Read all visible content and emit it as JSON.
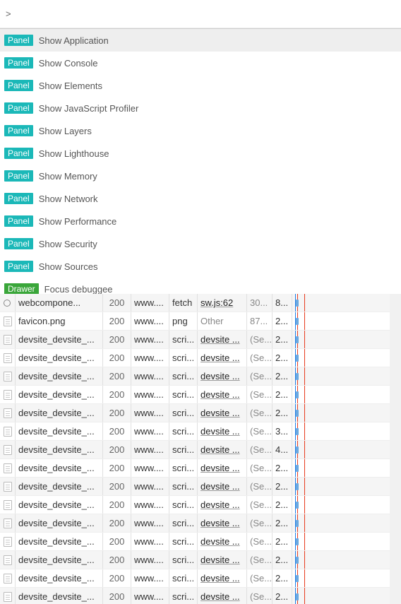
{
  "prompt": ">",
  "badges": {
    "panel": "Panel",
    "drawer": "Drawer"
  },
  "commands": [
    {
      "badge": "panel",
      "label": "Show Application",
      "selected": true
    },
    {
      "badge": "panel",
      "label": "Show Console"
    },
    {
      "badge": "panel",
      "label": "Show Elements"
    },
    {
      "badge": "panel",
      "label": "Show JavaScript Profiler"
    },
    {
      "badge": "panel",
      "label": "Show Layers"
    },
    {
      "badge": "panel",
      "label": "Show Lighthouse"
    },
    {
      "badge": "panel",
      "label": "Show Memory"
    },
    {
      "badge": "panel",
      "label": "Show Network"
    },
    {
      "badge": "panel",
      "label": "Show Performance"
    },
    {
      "badge": "panel",
      "label": "Show Security"
    },
    {
      "badge": "panel",
      "label": "Show Sources"
    },
    {
      "badge": "drawer",
      "label": "Focus debuggee"
    }
  ],
  "network": {
    "rows": [
      {
        "icon": "gear",
        "name": "webcompone...",
        "status": "200",
        "domain": "www....",
        "type": "fetch",
        "initiator": "sw.js:62",
        "init_is_link": true,
        "size": "30...",
        "time": "8..."
      },
      {
        "icon": "file",
        "name": "favicon.png",
        "status": "200",
        "domain": "www....",
        "type": "png",
        "initiator": "Other",
        "init_is_link": false,
        "size": "87...",
        "time": "2..."
      },
      {
        "icon": "file",
        "name": "devsite_devsite_...",
        "status": "200",
        "domain": "www....",
        "type": "scri...",
        "initiator": "devsite ...",
        "init_is_link": true,
        "size": "(Se...",
        "time": "2..."
      },
      {
        "icon": "file",
        "name": "devsite_devsite_...",
        "status": "200",
        "domain": "www....",
        "type": "scri...",
        "initiator": "devsite ...",
        "init_is_link": true,
        "size": "(Se...",
        "time": "2..."
      },
      {
        "icon": "file",
        "name": "devsite_devsite_...",
        "status": "200",
        "domain": "www....",
        "type": "scri...",
        "initiator": "devsite ...",
        "init_is_link": true,
        "size": "(Se...",
        "time": "2..."
      },
      {
        "icon": "file",
        "name": "devsite_devsite_...",
        "status": "200",
        "domain": "www....",
        "type": "scri...",
        "initiator": "devsite ...",
        "init_is_link": true,
        "size": "(Se...",
        "time": "2..."
      },
      {
        "icon": "file",
        "name": "devsite_devsite_...",
        "status": "200",
        "domain": "www....",
        "type": "scri...",
        "initiator": "devsite ...",
        "init_is_link": true,
        "size": "(Se...",
        "time": "2..."
      },
      {
        "icon": "file",
        "name": "devsite_devsite_...",
        "status": "200",
        "domain": "www....",
        "type": "scri...",
        "initiator": "devsite ...",
        "init_is_link": true,
        "size": "(Se...",
        "time": "3..."
      },
      {
        "icon": "file",
        "name": "devsite_devsite_...",
        "status": "200",
        "domain": "www....",
        "type": "scri...",
        "initiator": "devsite ...",
        "init_is_link": true,
        "size": "(Se...",
        "time": "4..."
      },
      {
        "icon": "file",
        "name": "devsite_devsite_...",
        "status": "200",
        "domain": "www....",
        "type": "scri...",
        "initiator": "devsite ...",
        "init_is_link": true,
        "size": "(Se...",
        "time": "2..."
      },
      {
        "icon": "file",
        "name": "devsite_devsite_...",
        "status": "200",
        "domain": "www....",
        "type": "scri...",
        "initiator": "devsite ...",
        "init_is_link": true,
        "size": "(Se...",
        "time": "2..."
      },
      {
        "icon": "file",
        "name": "devsite_devsite_...",
        "status": "200",
        "domain": "www....",
        "type": "scri...",
        "initiator": "devsite ...",
        "init_is_link": true,
        "size": "(Se...",
        "time": "2..."
      },
      {
        "icon": "file",
        "name": "devsite_devsite_...",
        "status": "200",
        "domain": "www....",
        "type": "scri...",
        "initiator": "devsite ...",
        "init_is_link": true,
        "size": "(Se...",
        "time": "2..."
      },
      {
        "icon": "file",
        "name": "devsite_devsite_...",
        "status": "200",
        "domain": "www....",
        "type": "scri...",
        "initiator": "devsite ...",
        "init_is_link": true,
        "size": "(Se...",
        "time": "2..."
      },
      {
        "icon": "file",
        "name": "devsite_devsite_...",
        "status": "200",
        "domain": "www....",
        "type": "scri...",
        "initiator": "devsite ...",
        "init_is_link": true,
        "size": "(Se...",
        "time": "2..."
      },
      {
        "icon": "file",
        "name": "devsite_devsite_...",
        "status": "200",
        "domain": "www....",
        "type": "scri...",
        "initiator": "devsite ...",
        "init_is_link": true,
        "size": "(Se...",
        "time": "2..."
      },
      {
        "icon": "file",
        "name": "devsite_devsite_...",
        "status": "200",
        "domain": "www....",
        "type": "scri...",
        "initiator": "devsite ...",
        "init_is_link": true,
        "size": "(Se...",
        "time": "2..."
      }
    ]
  }
}
